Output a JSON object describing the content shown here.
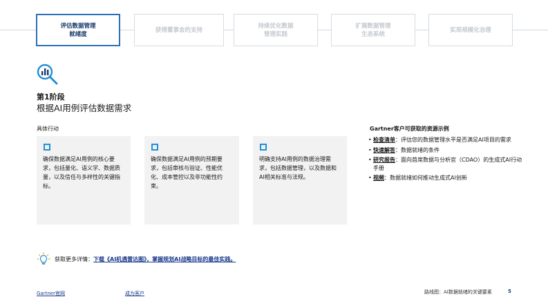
{
  "steps": [
    "评估数据管理\n就绪度",
    "获得董事会的支持",
    "持续优化数据\n管理实践",
    "扩展数据管理\n生态系统",
    "实现规模化治理"
  ],
  "stage": {
    "icon": "magnifier-chart-icon",
    "label": "第1阶段",
    "description": "根据AI用例评估数据需求"
  },
  "actions": {
    "title": "具体行动",
    "cards": [
      "确保数据满足AI用例的核心要求，包括量化、语义学、数据质量，以及信任与多样性的关键指标。",
      "确保数据满足AI用例的预期要求，包括审核与验证、性能优化、成本管控以及非功能性约束。",
      "明确支持AI用例的数据治理需求，包括数据管理，以及数据和AI相关标准与法规。"
    ]
  },
  "resources": {
    "title": "Gartner客户可获取的资源示例",
    "items": [
      {
        "key": "检查清单",
        "text": "：评估您的数据管理水平是否满足AI项目的需求"
      },
      {
        "key": "快速解答",
        "text": "：数据就绪的条件"
      },
      {
        "key": "研究报告",
        "text": "：面向首席数据与分析官（CDAO）的生成式AI行动手册"
      },
      {
        "key": "视频",
        "text": "：数据就绪如何推动生成式AI创新"
      }
    ]
  },
  "more": {
    "icon": "lightbulb-icon",
    "prefix": "获取更多详情：",
    "link": "下载《AI机遇雷达图》，掌握规划AI战略目标的最佳实践。"
  },
  "footer": {
    "official": "Gartner官网",
    "become_client": "成为客户",
    "right": "路线图：AI数据就绪的关键要素",
    "page": "5"
  },
  "colors": {
    "accent": "#2a6fb5",
    "checkbox": "#1f8fd6",
    "card_bg": "#f2f2f2"
  }
}
